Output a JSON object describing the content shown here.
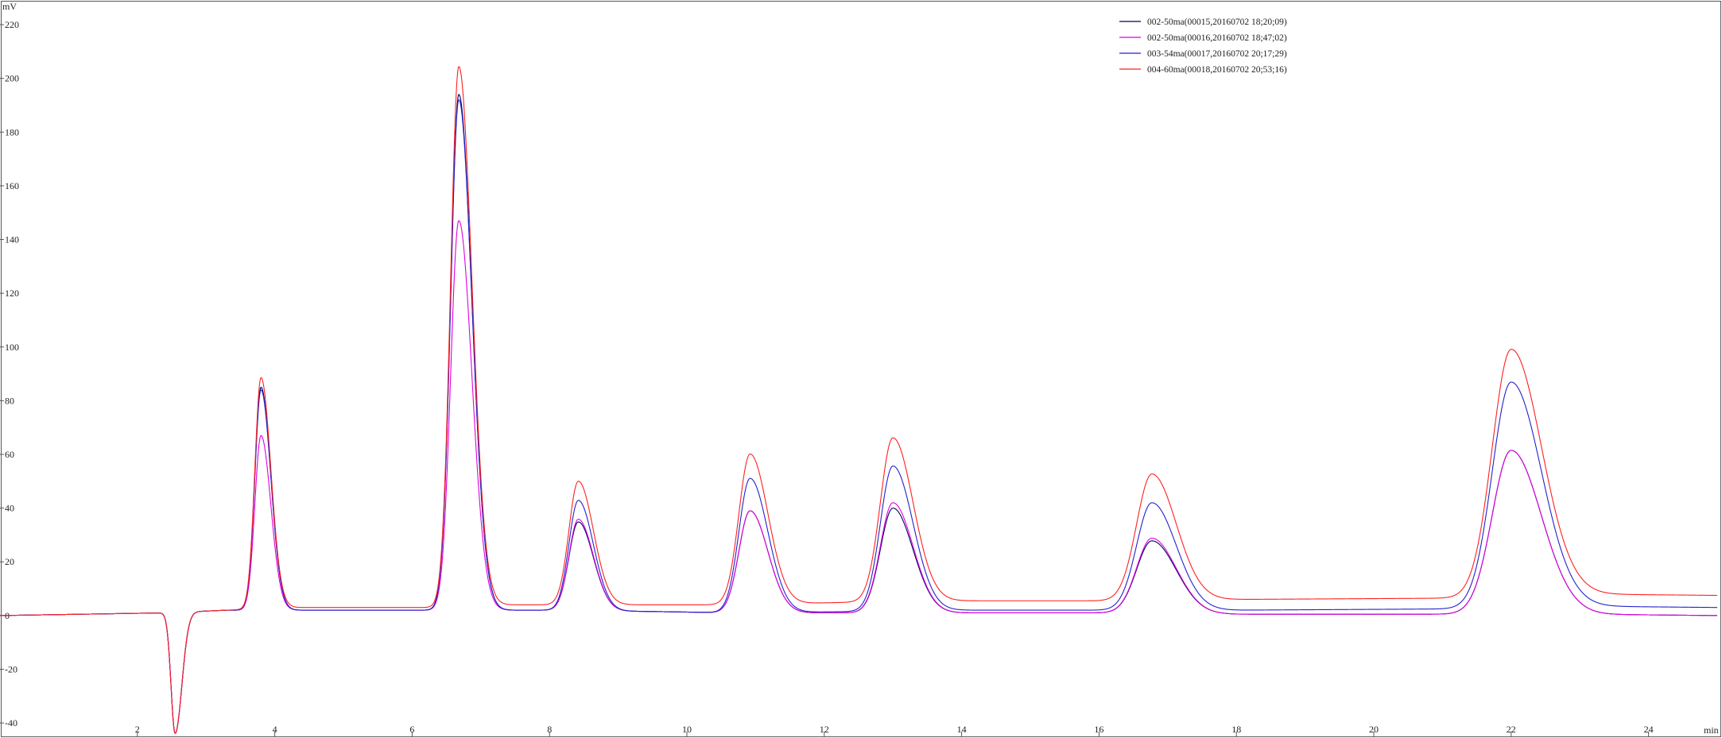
{
  "chart_data": {
    "type": "line",
    "ylabel": "mV",
    "xlabel": "min",
    "xlim": [
      0,
      25
    ],
    "ylim": [
      -45,
      228
    ],
    "x_ticks": [
      2,
      4,
      6,
      8,
      10,
      12,
      14,
      16,
      18,
      20,
      22,
      24
    ],
    "y_ticks": [
      -40,
      -20,
      0,
      20,
      40,
      60,
      80,
      100,
      120,
      140,
      160,
      180,
      200,
      220
    ],
    "grid": false,
    "legend_position": "top-right",
    "negative_dip": {
      "time": 2.55,
      "depth": -45,
      "width": 0.075
    },
    "series": [
      {
        "name": "002-50ma(00015,20160702  18;20;09)",
        "color": "#000066",
        "peaks": [
          {
            "time": 3.8,
            "height": 83
          },
          {
            "time": 6.68,
            "height": 192
          },
          {
            "time": 8.42,
            "height": 33
          },
          {
            "time": 10.92,
            "height": 38
          },
          {
            "time": 13.0,
            "height": 39
          },
          {
            "time": 16.77,
            "height": 27
          },
          {
            "time": 22.0,
            "height": 61
          }
        ],
        "baseline": [
          [
            0,
            0
          ],
          [
            2.4,
            1
          ],
          [
            3.3,
            2
          ],
          [
            4.2,
            2
          ],
          [
            6.3,
            2
          ],
          [
            7.3,
            2
          ],
          [
            8.0,
            2
          ],
          [
            9.5,
            1.5
          ],
          [
            10.7,
            1
          ],
          [
            12.5,
            1
          ],
          [
            14.0,
            1
          ],
          [
            16.0,
            1
          ],
          [
            18.0,
            0.5
          ],
          [
            21.3,
            0.5
          ],
          [
            23.0,
            0.5
          ],
          [
            25.0,
            0
          ]
        ]
      },
      {
        "name": "002-50ma(00016,20160702  18;47;02)",
        "color": "#e000e0",
        "peaks": [
          {
            "time": 3.8,
            "height": 65
          },
          {
            "time": 6.68,
            "height": 145
          },
          {
            "time": 8.42,
            "height": 34
          },
          {
            "time": 10.92,
            "height": 38
          },
          {
            "time": 13.0,
            "height": 41
          },
          {
            "time": 16.77,
            "height": 28
          },
          {
            "time": 22.0,
            "height": 61
          }
        ],
        "baseline": [
          [
            0,
            0
          ],
          [
            2.4,
            1
          ],
          [
            3.3,
            2
          ],
          [
            4.2,
            2
          ],
          [
            6.3,
            2
          ],
          [
            7.3,
            2
          ],
          [
            8.0,
            2
          ],
          [
            9.5,
            1.5
          ],
          [
            10.7,
            1
          ],
          [
            12.5,
            1
          ],
          [
            14.0,
            1
          ],
          [
            16.0,
            1
          ],
          [
            18.0,
            0.5
          ],
          [
            21.3,
            0.5
          ],
          [
            23.0,
            0.5
          ],
          [
            25.0,
            0
          ]
        ]
      },
      {
        "name": "003-54ma(00017,20160702  20;17;29)",
        "color": "#2222cc",
        "peaks": [
          {
            "time": 3.8,
            "height": 82
          },
          {
            "time": 6.68,
            "height": 190
          },
          {
            "time": 8.42,
            "height": 41
          },
          {
            "time": 10.92,
            "height": 50
          },
          {
            "time": 13.0,
            "height": 54
          },
          {
            "time": 16.77,
            "height": 40
          },
          {
            "time": 22.0,
            "height": 84
          }
        ],
        "baseline": [
          [
            0,
            0
          ],
          [
            2.4,
            1
          ],
          [
            3.3,
            2
          ],
          [
            4.2,
            2
          ],
          [
            6.3,
            2
          ],
          [
            7.3,
            2
          ],
          [
            8.0,
            2
          ],
          [
            9.5,
            1.5
          ],
          [
            10.7,
            1
          ],
          [
            12.5,
            1.5
          ],
          [
            14.0,
            2
          ],
          [
            16.0,
            2
          ],
          [
            18.0,
            2
          ],
          [
            21.3,
            2.5
          ],
          [
            23.0,
            3.5
          ],
          [
            25.0,
            3
          ]
        ]
      },
      {
        "name": "004-60ma(00018,20160702  20;53;16)",
        "color": "#ff2020",
        "peaks": [
          {
            "time": 3.8,
            "height": 86
          },
          {
            "time": 6.68,
            "height": 201
          },
          {
            "time": 8.42,
            "height": 46
          },
          {
            "time": 10.92,
            "height": 56
          },
          {
            "time": 13.0,
            "height": 61
          },
          {
            "time": 16.77,
            "height": 47
          },
          {
            "time": 22.0,
            "height": 92
          }
        ],
        "baseline": [
          [
            0,
            0
          ],
          [
            2.4,
            1
          ],
          [
            3.3,
            2
          ],
          [
            4.2,
            3
          ],
          [
            6.3,
            3
          ],
          [
            7.3,
            4
          ],
          [
            8.0,
            4
          ],
          [
            9.5,
            4
          ],
          [
            10.7,
            4
          ],
          [
            12.5,
            5
          ],
          [
            14.0,
            5.5
          ],
          [
            16.0,
            5.5
          ],
          [
            18.0,
            6
          ],
          [
            21.3,
            6.5
          ],
          [
            23.0,
            8
          ],
          [
            25.0,
            7.5
          ]
        ]
      }
    ]
  }
}
